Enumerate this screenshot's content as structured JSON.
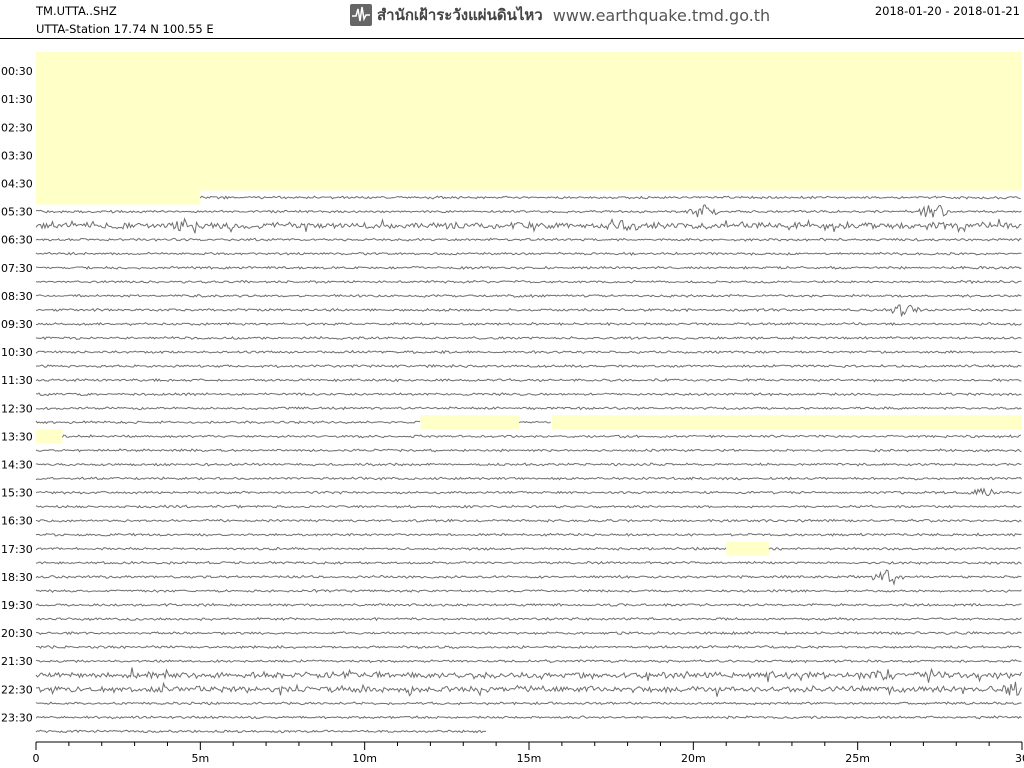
{
  "header": {
    "station_code": "TM.UTTA..SHZ",
    "station_info": "UTTA-Station  17.74 N 100.55 E",
    "org_name": "สำนักเฝ้าระวังแผ่นดินไหว",
    "website": "www.earthquake.tmd.go.th",
    "date_range": "2018-01-20 - 2018-01-21"
  },
  "logo": {
    "icon": "seismograph-logo-icon"
  },
  "chart_data": {
    "type": "helicorder",
    "trace_color": "#6e6e6e",
    "gap_color": "#ffffc8",
    "row_labels": [
      "00:30",
      "01:30",
      "02:30",
      "03:30",
      "04:30",
      "05:30",
      "06:30",
      "07:30",
      "08:30",
      "09:30",
      "10:30",
      "11:30",
      "12:30",
      "13:30",
      "14:30",
      "15:30",
      "16:30",
      "17:30",
      "18:30",
      "19:30",
      "20:30",
      "21:30",
      "22:30",
      "23:30"
    ],
    "x_axis": {
      "range": [
        0,
        30
      ],
      "unit": "minutes",
      "tick_labels": [
        {
          "value": 0,
          "label": "0"
        },
        {
          "value": 5,
          "label": "5m"
        },
        {
          "value": 10,
          "label": "10m"
        },
        {
          "value": 15,
          "label": "15m"
        },
        {
          "value": 20,
          "label": "20m"
        },
        {
          "value": 25,
          "label": "25m"
        },
        {
          "value": 30,
          "label": "30"
        }
      ]
    },
    "data_start": {
      "line": 10,
      "minute": 5.0
    },
    "data_end": {
      "line": 48,
      "minute": 13.7
    },
    "gaps": [
      {
        "line": 26,
        "from": 11.7,
        "to": 14.7
      },
      {
        "line": 26,
        "from": 15.7,
        "to": 30
      },
      {
        "line": 27,
        "from": 0,
        "to": 0.8
      },
      {
        "line": 35,
        "from": 21.0,
        "to": 22.3
      }
    ],
    "high_noise_lines": [
      12,
      44,
      45
    ],
    "events": [
      {
        "line": 11,
        "minute": 20.3,
        "amp": 3
      },
      {
        "line": 11,
        "minute": 27.3,
        "amp": 4
      },
      {
        "line": 12,
        "minute": 4.5,
        "amp": 3
      },
      {
        "line": 12,
        "minute": 18.0,
        "amp": 3
      },
      {
        "line": 18,
        "minute": 26.4,
        "amp": 3
      },
      {
        "line": 31,
        "minute": 28.8,
        "amp": 2
      },
      {
        "line": 37,
        "minute": 25.9,
        "amp": 5
      },
      {
        "line": 44,
        "minute": 25.8,
        "amp": 3
      },
      {
        "line": 45,
        "minute": 29.8,
        "amp": 4
      }
    ]
  }
}
